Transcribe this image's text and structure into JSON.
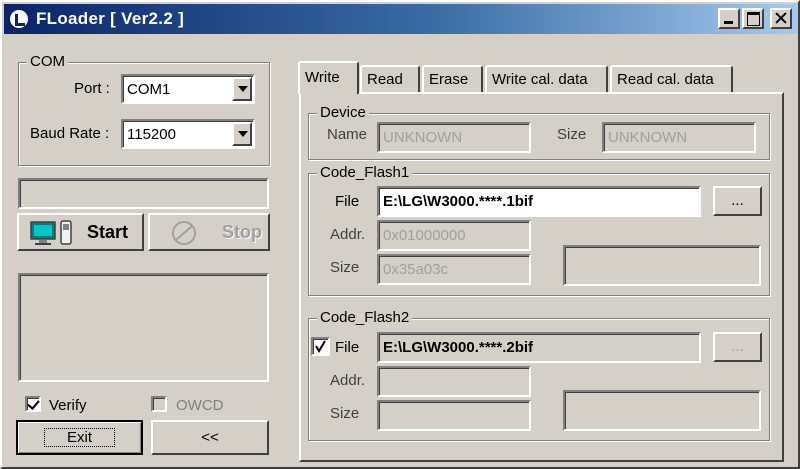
{
  "window": {
    "title": "FLoader [ Ver2.2 ]"
  },
  "com": {
    "legend": "COM",
    "port_label": "Port :",
    "port_value": "COM1",
    "baud_label": "Baud Rate :",
    "baud_value": "115200"
  },
  "controls": {
    "start_label": "Start",
    "stop_label": "Stop",
    "verify_label": "Verify",
    "verify_checked": true,
    "owcd_label": "OWCD",
    "owcd_checked": false,
    "exit_label": "Exit",
    "collapse_label": "<<"
  },
  "tabs": [
    {
      "label": "Write",
      "active": true
    },
    {
      "label": "Read"
    },
    {
      "label": "Erase"
    },
    {
      "label": "Write cal. data"
    },
    {
      "label": "Read cal. data"
    }
  ],
  "device": {
    "legend": "Device",
    "name_label": "Name",
    "name_value": "UNKNOWN",
    "size_label": "Size",
    "size_value": "UNKNOWN"
  },
  "code_flash1": {
    "legend": "Code_Flash1",
    "file_label": "File",
    "file_value": "E:\\LG\\W3000.****.1bif",
    "browse_label": "...",
    "addr_label": "Addr.",
    "addr_value": "0x01000000",
    "size_label": "Size",
    "size_value": "0x35a03c"
  },
  "code_flash2": {
    "legend": "Code_Flash2",
    "file_checked": true,
    "file_label": "File",
    "file_value": "E:\\LG\\W3000.****.2bif",
    "browse_label": "...",
    "addr_label": "Addr.",
    "addr_value": "",
    "size_label": "Size",
    "size_value": ""
  }
}
